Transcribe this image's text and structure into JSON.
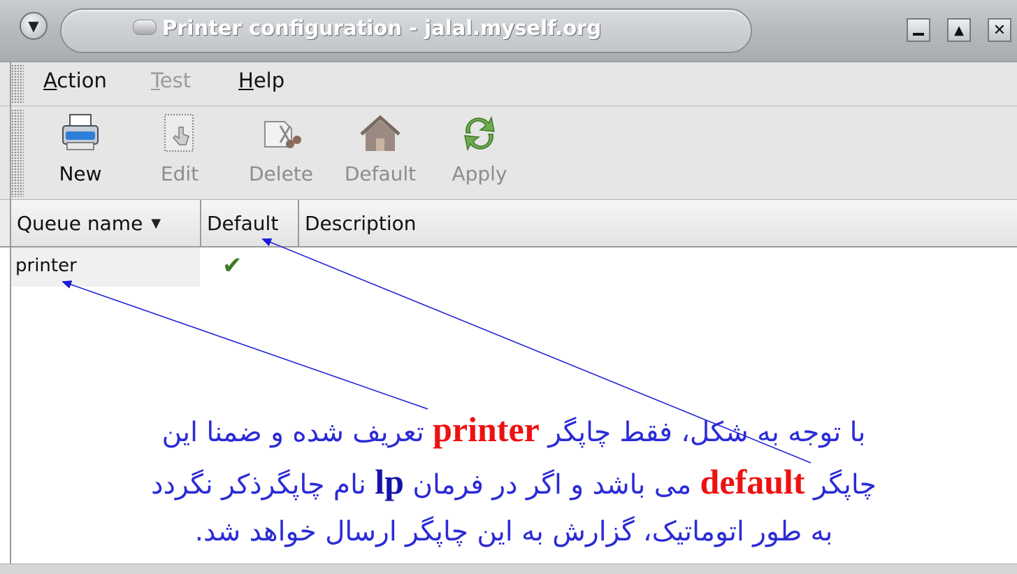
{
  "window": {
    "title": "Printer configuration - jalal.myself.org",
    "controls": [
      "minimize",
      "maximize",
      "close"
    ]
  },
  "menubar": {
    "items": [
      {
        "label": "Action",
        "mnemonic": "A",
        "enabled": true
      },
      {
        "label": "Test",
        "mnemonic": "T",
        "enabled": false
      },
      {
        "label": "Help",
        "mnemonic": "H",
        "enabled": true
      }
    ]
  },
  "toolbar": {
    "buttons": [
      {
        "label": "New",
        "icon": "new-printer-icon",
        "enabled": true
      },
      {
        "label": "Edit",
        "icon": "edit-icon",
        "enabled": false
      },
      {
        "label": "Delete",
        "icon": "delete-icon",
        "enabled": false
      },
      {
        "label": "Default",
        "icon": "home-icon",
        "enabled": false
      },
      {
        "label": "Apply",
        "icon": "refresh-icon",
        "enabled": false
      }
    ]
  },
  "table": {
    "columns": [
      "Queue name",
      "Default",
      "Description"
    ],
    "sort_column": "Queue name",
    "rows": [
      {
        "queue_name": "printer",
        "default": true,
        "description": ""
      }
    ]
  },
  "annotation": {
    "line1_pre": "با توجه به شکل، فقط چاپگر",
    "line1_kw": "printer",
    "line1_post": "تعریف شده و ضمنا  این",
    "line2_pre": "چاپگر",
    "line2_kw": "default",
    "line2_mid": "می باشد و اگر در فرمان",
    "line2_kw2": "lp",
    "line2_post": "نام چاپگرذکر نگردد",
    "line3": "به طور اتوماتیک، گزارش به این چاپگر ارسال خواهد شد.",
    "colors": {
      "text": "#2b2bd6",
      "keyword": "#ee1111",
      "keyword2": "#1414a8",
      "arrow": "#1a1ad8"
    }
  }
}
